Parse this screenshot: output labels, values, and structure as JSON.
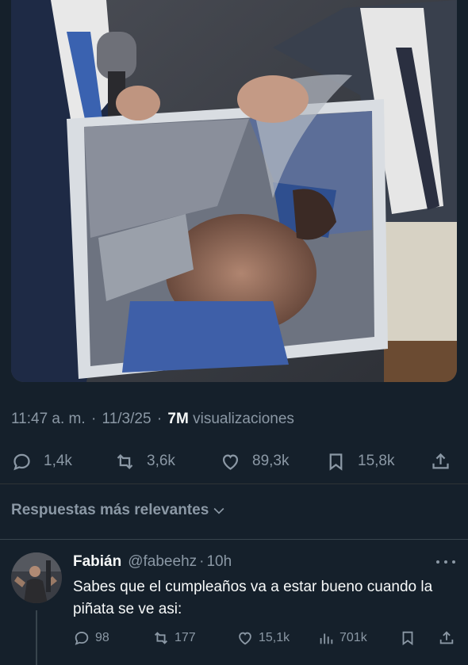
{
  "post": {
    "time": "11:47 a. m.",
    "date": "11/3/25",
    "separator": "·",
    "views_count": "7M",
    "views_label": "visualizaciones",
    "stats": {
      "replies": "1,4k",
      "reposts": "3,6k",
      "likes": "89,3k",
      "bookmarks": "15,8k"
    }
  },
  "sort": {
    "label": "Respuestas más relevantes"
  },
  "reply": {
    "name": "Fabián",
    "handle": "@fabeehz",
    "separator": "·",
    "time": "10h",
    "text": "Sabes que el cumpleaños va a estar bueno cuando la piñata se ve asi:",
    "stats": {
      "replies": "98",
      "reposts": "177",
      "likes": "15,1k",
      "views": "701k"
    }
  },
  "colors": {
    "background": "#15202b",
    "text_primary": "#f7f9f9",
    "text_secondary": "#8b98a5",
    "divider": "#38444d"
  },
  "icons": {
    "reply": "speech-bubble-icon",
    "repost": "repost-arrows-icon",
    "like": "heart-icon",
    "bookmark": "bookmark-icon",
    "share": "share-icon",
    "views": "bar-chart-icon",
    "more": "ellipsis-icon",
    "sort": "chevron-down-icon"
  }
}
